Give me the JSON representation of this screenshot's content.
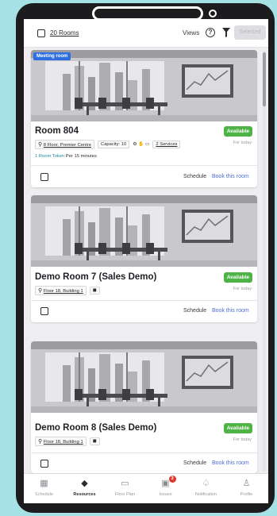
{
  "toolbar": {
    "rooms_count": "20 Rooms",
    "views_label": "Views",
    "help_icon": "?",
    "selected_label": "Selected"
  },
  "rooms": [
    {
      "tag": "Meeting room",
      "name": "Room 804",
      "status": "Available",
      "status_sub": "For today",
      "location": "8 Floor, Premier Centre",
      "capacity": "Capacity: 10",
      "amenities": "⚙ ✋ ▭",
      "services": "2 Services",
      "token_highlight": "1 Room Token",
      "token_rest": " Per 15 minutes",
      "schedule": "Schedule",
      "book": "Book this room"
    },
    {
      "name": "Demo Room 7 (Sales Demo)",
      "status": "Available",
      "status_sub": "For today",
      "location": "Floor 18, Building 1",
      "amenities": "◼",
      "schedule": "Schedule",
      "book": "Book this room"
    },
    {
      "name": "Demo Room 8 (Sales Demo)",
      "status": "Available",
      "status_sub": "For today",
      "location": "Floor 18, Building 1",
      "amenities": "◼",
      "schedule": "Schedule",
      "book": "Book this room"
    }
  ],
  "nav": [
    {
      "label": "Schedule",
      "icon": "calendar-icon",
      "glyph": "▦"
    },
    {
      "label": "Resources",
      "icon": "resources-icon",
      "glyph": "◆"
    },
    {
      "label": "Floor Plan",
      "icon": "floor-plan-icon",
      "glyph": "▭"
    },
    {
      "label": "Issues",
      "icon": "issues-icon",
      "glyph": "▣",
      "badge": "3"
    },
    {
      "label": "Notification",
      "icon": "bell-icon",
      "glyph": "♤"
    },
    {
      "label": "Profile",
      "icon": "profile-icon",
      "glyph": "♙"
    }
  ],
  "colors": {
    "available": "#4fb446",
    "link": "#4a6fd4",
    "tag": "#2f6ee0",
    "background": "#a6e2e5"
  }
}
